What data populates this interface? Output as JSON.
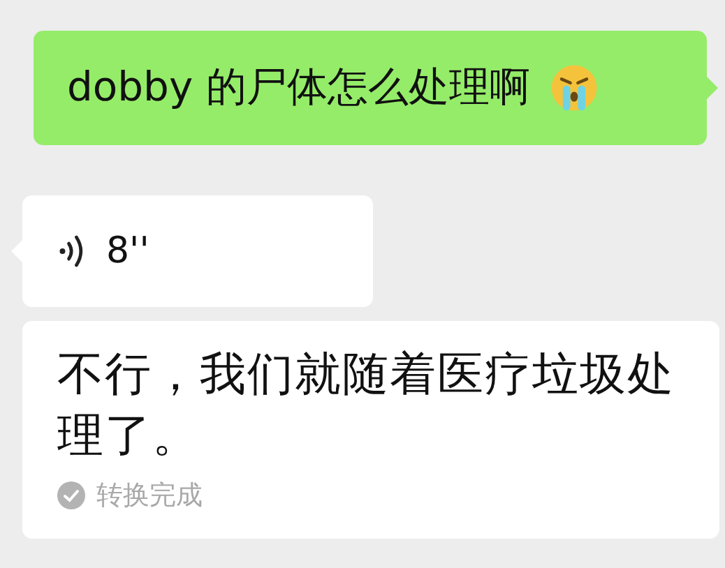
{
  "messages": [
    {
      "kind": "text",
      "text": "dobby 的尸体怎么处理啊"
    },
    {
      "kind": "voice",
      "duration": "8''"
    },
    {
      "kind": "transcript",
      "text": "不行，我们就随着医疗垃圾处理了。",
      "status": "转换完成"
    }
  ]
}
